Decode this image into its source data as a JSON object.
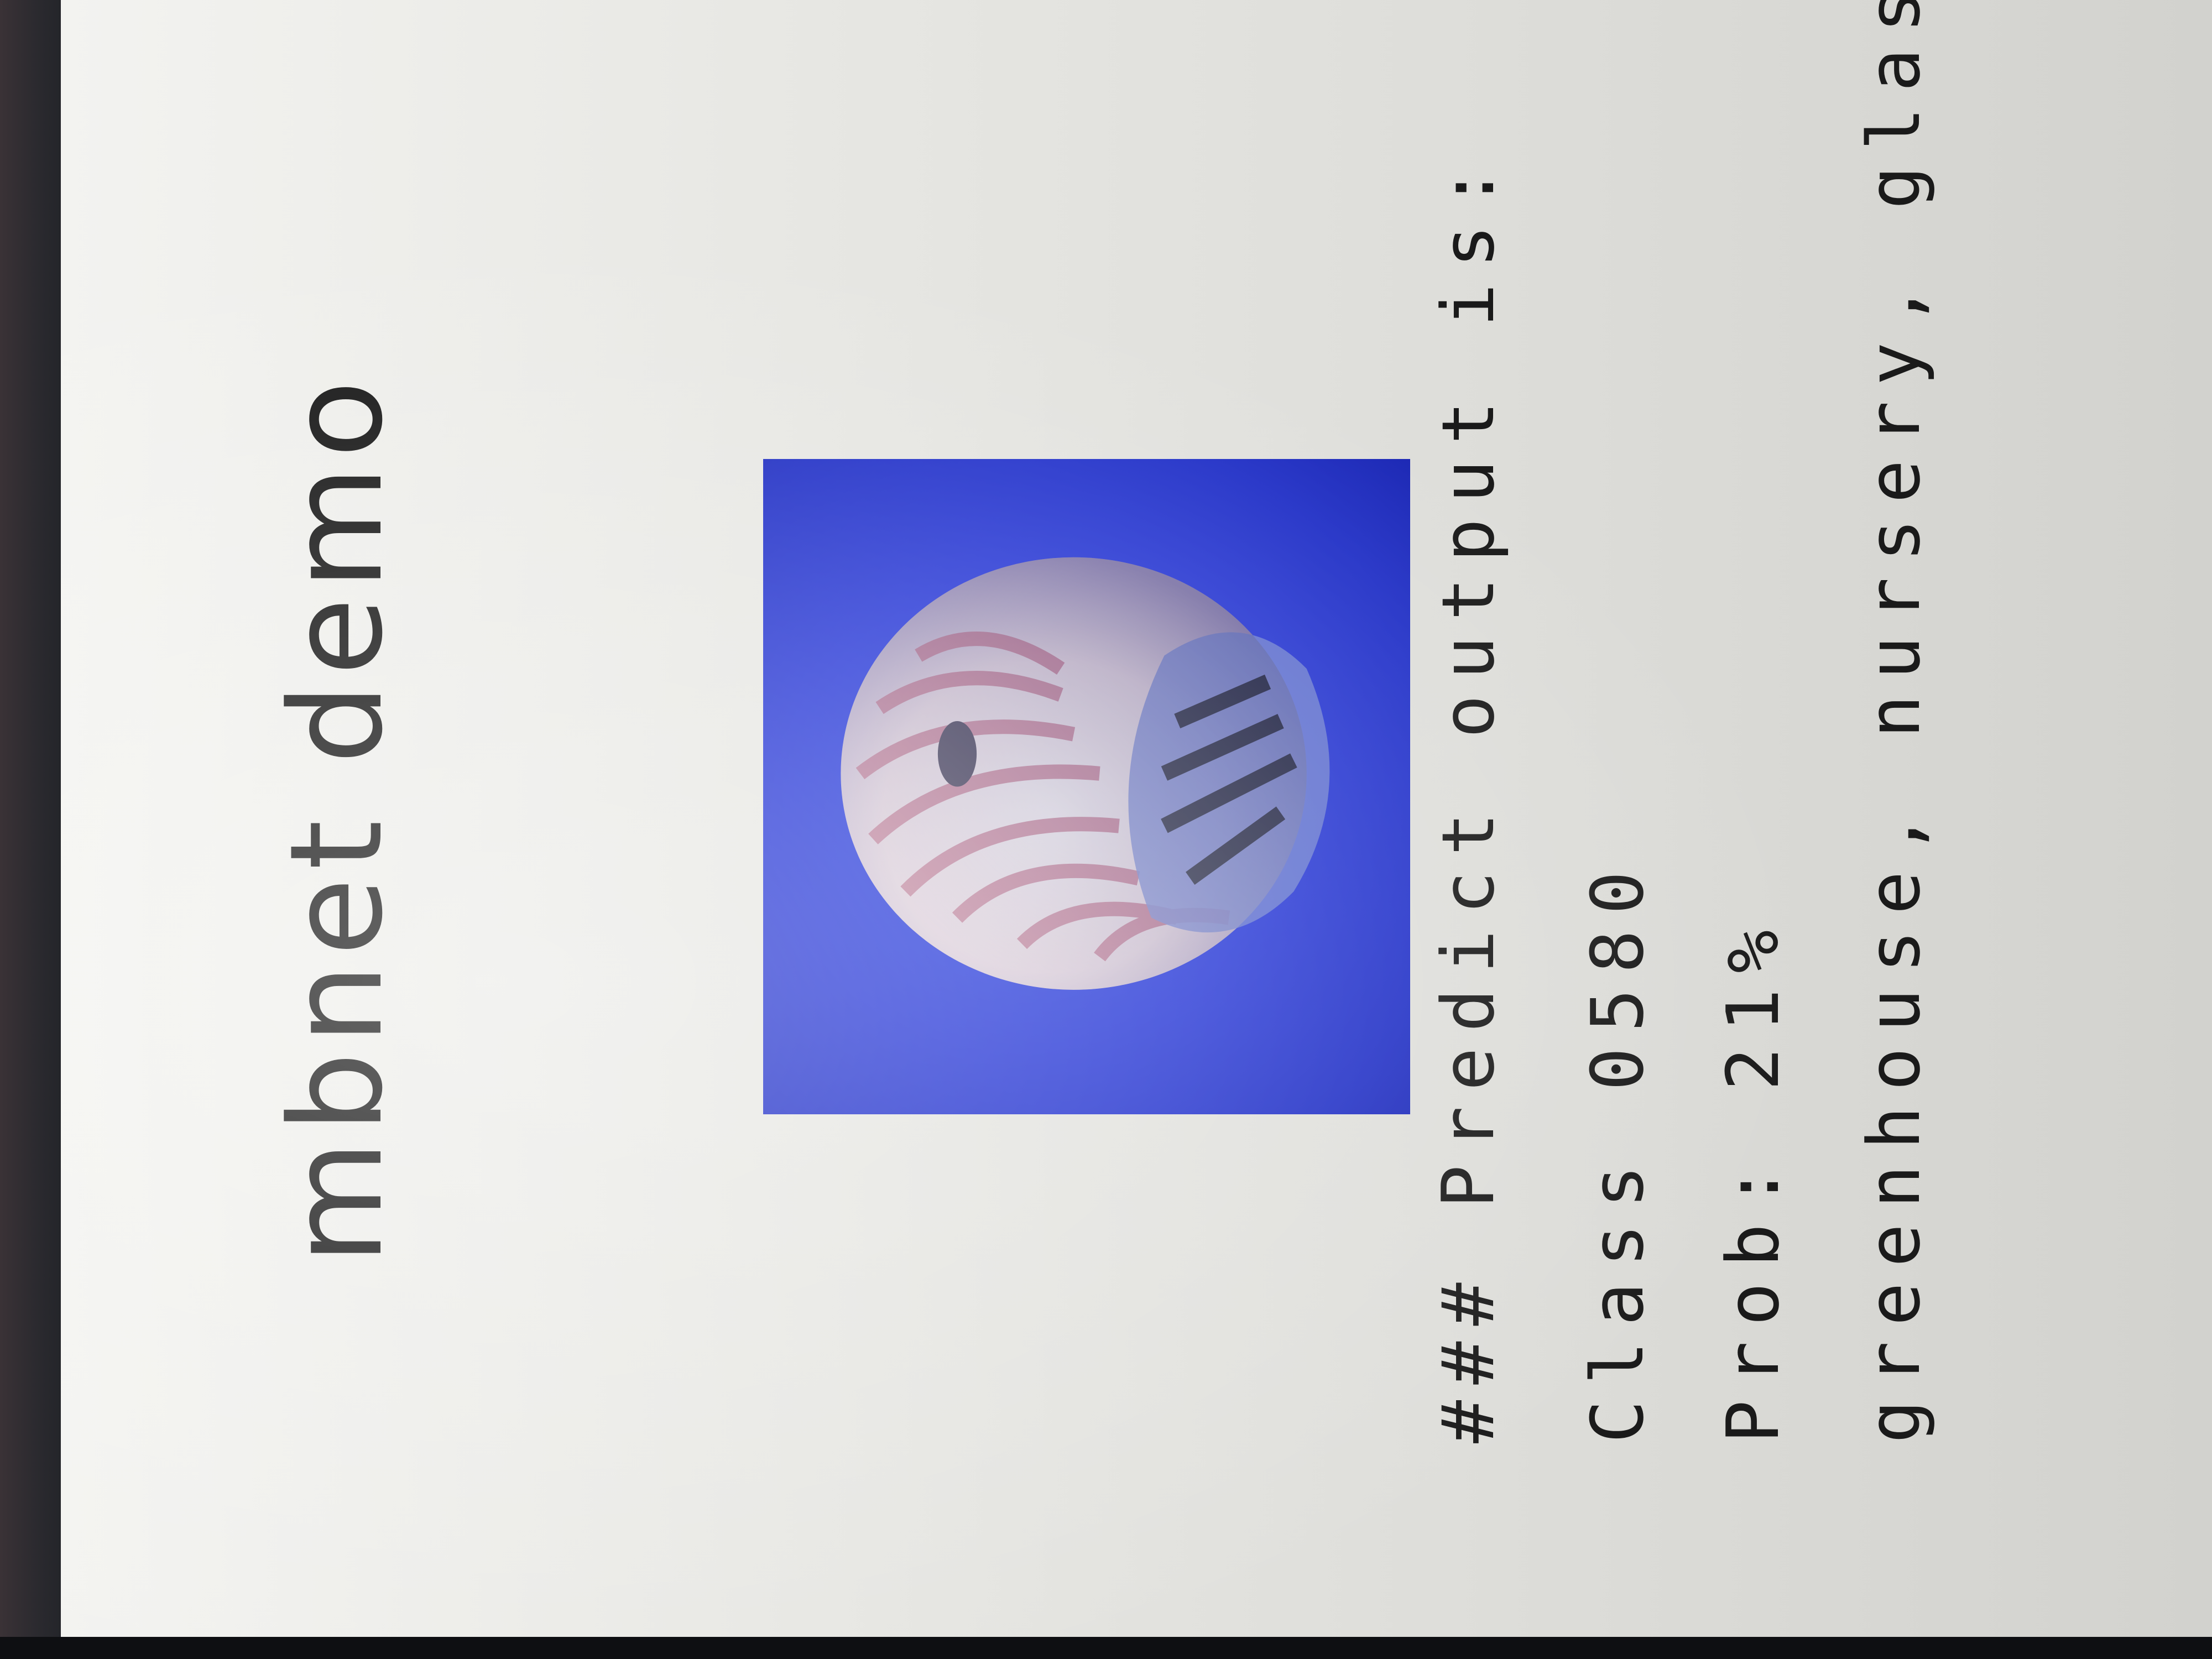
{
  "app": {
    "title": "mbnet demo"
  },
  "prediction": {
    "header": "### Predict output is:",
    "class_line": "Class 0580",
    "prob_line": "Prob: 21%",
    "labels_line": "greenhouse, nursery, glasshouse",
    "probability_percent": 21,
    "class_id": "0580"
  },
  "input_image": {
    "subject": "nautilus-shell-photo",
    "background_color": "#2a38d0"
  },
  "colors": {
    "screen_bg": "#e6e6e2",
    "text": "#1a1a1a"
  }
}
